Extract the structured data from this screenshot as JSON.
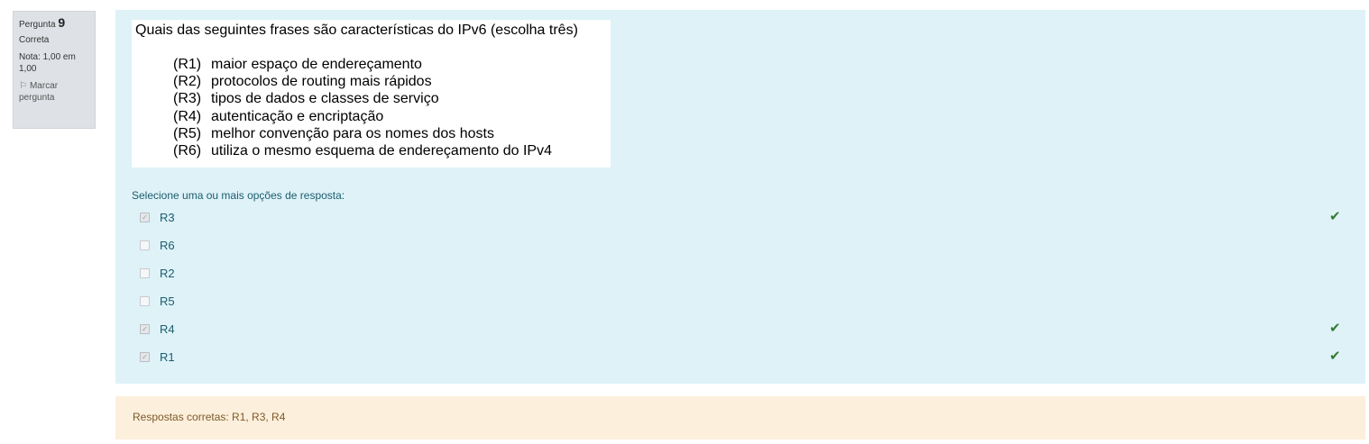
{
  "info": {
    "question_label": "Pergunta",
    "question_number": "9",
    "state": "Correta",
    "grade": "Nota: 1,00 em 1,00",
    "flag_label": "Marcar pergunta",
    "flag_icon": "flag-icon"
  },
  "question": {
    "title": "Quais das seguintes frases são características do IPv6 (escolha três)",
    "statements": [
      {
        "code": "(R1)",
        "text": "maior espaço de endereçamento"
      },
      {
        "code": "(R2)",
        "text": "protocolos de routing mais rápidos"
      },
      {
        "code": "(R3)",
        "text": "tipos de dados e classes de serviço"
      },
      {
        "code": "(R4)",
        "text": "autenticação e encriptação"
      },
      {
        "code": "(R5)",
        "text": "melhor convenção para os nomes dos hosts"
      },
      {
        "code": "(R6)",
        "text": "utiliza o mesmo esquema de endereçamento do IPv4"
      }
    ],
    "prompt": "Selecione uma ou mais opções de resposta:"
  },
  "answers": [
    {
      "label": "R3",
      "checked": true,
      "correct": true
    },
    {
      "label": "R6",
      "checked": false,
      "correct": false
    },
    {
      "label": "R2",
      "checked": false,
      "correct": false
    },
    {
      "label": "R5",
      "checked": false,
      "correct": false
    },
    {
      "label": "R4",
      "checked": true,
      "correct": true
    },
    {
      "label": "R1",
      "checked": true,
      "correct": true
    }
  ],
  "feedback": {
    "right_answer": "Respostas corretas: R1, R3, R4"
  },
  "colors": {
    "content_bg": "#def2f8",
    "outcome_bg": "#fcefdc",
    "info_bg": "#dee2e6",
    "tick": "#357a32"
  }
}
